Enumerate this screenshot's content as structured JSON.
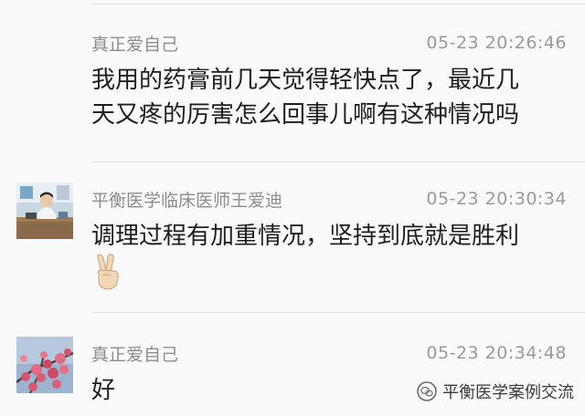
{
  "messages": [
    {
      "author": "真正爱自己",
      "time": "05-23 20:26:46",
      "lines": [
        "我用的药膏前几天觉得轻快点了，最近几",
        "天又疼的厉害怎么回事儿啊有这种情况吗"
      ]
    },
    {
      "author": "平衡医学临床医师王爱迪",
      "time": "05-23 20:30:34",
      "lines": [
        "调理过程有加重情况，坚持到底就是胜利"
      ],
      "emoji": "✌🏼"
    },
    {
      "author": "真正爱自己",
      "time": "05-23 20:34:48",
      "lines": [
        "好"
      ]
    }
  ],
  "watermark": {
    "text": "平衡医学案例交流"
  },
  "colors": {
    "name": "#8d8d8d",
    "time": "#9a9a9a",
    "text": "#1e1e1e",
    "divider": "#e3e3e3"
  }
}
